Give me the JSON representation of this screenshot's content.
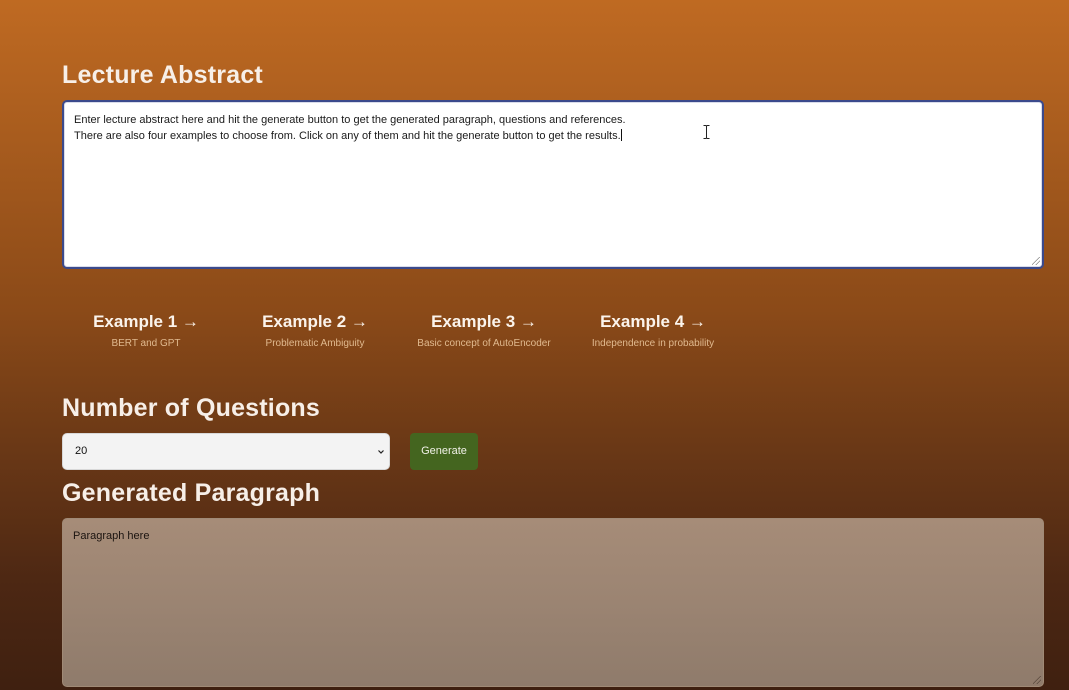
{
  "abstract": {
    "title": "Lecture Abstract",
    "line1": "Enter lecture abstract here and hit the generate button to get the generated paragraph, questions and references.",
    "line2": "There are also four examples to choose from. Click on any of them and hit the generate button to get the results."
  },
  "examples": [
    {
      "label": "Example 1 →",
      "subtitle": "BERT and GPT"
    },
    {
      "label": "Example 2 →",
      "subtitle": "Problematic Ambiguity"
    },
    {
      "label": "Example 3 →",
      "subtitle": "Basic concept of AutoEncoder"
    },
    {
      "label": "Example 4 →",
      "subtitle": "Independence in probability"
    }
  ],
  "questions": {
    "title": "Number of Questions",
    "selected": "20"
  },
  "generate_button": {
    "label": "Generate"
  },
  "paragraph": {
    "title": "Generated Paragraph",
    "placeholder": "Paragraph here"
  },
  "colors": {
    "background_top": "#bf6a22",
    "background_bottom": "#3f2010",
    "generate_button": "#44651f",
    "textarea_border": "#3b4a8c"
  },
  "icons": {
    "select_chevron": "chevron-down-icon",
    "text_cursor": "text-cursor-icon",
    "resize_handle": "resize-handle-icon"
  }
}
